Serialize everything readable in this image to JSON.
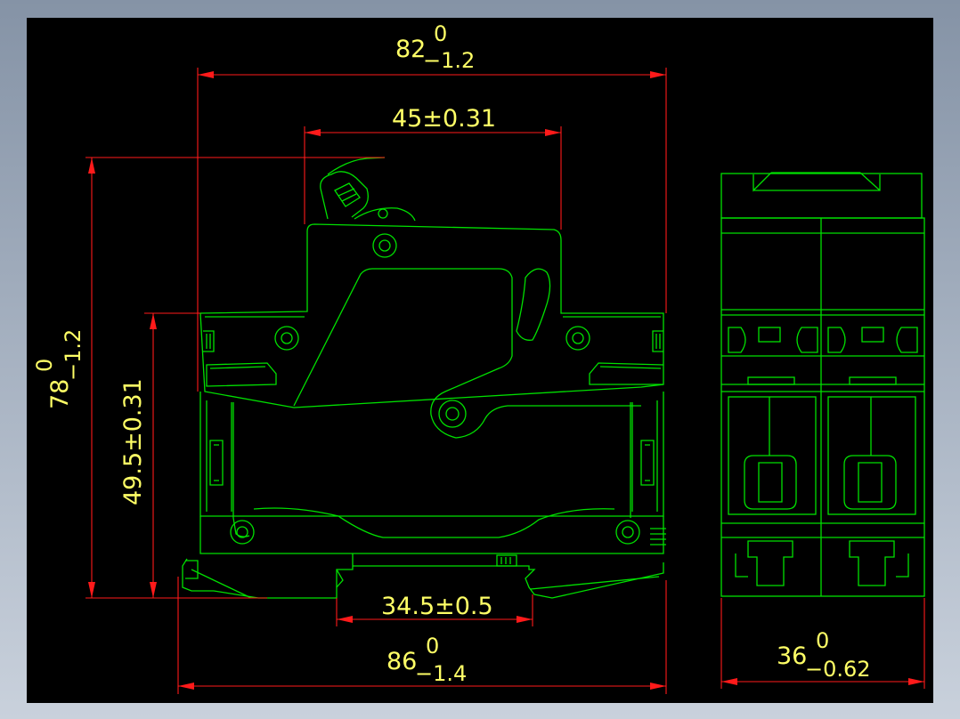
{
  "colors": {
    "viewport_background": "#000000",
    "outline": "#00e000",
    "dimension_line": "#ff1a1a",
    "dimension_text": "#ffff66"
  },
  "dimensions": {
    "top_width": {
      "nominal": "82",
      "upper": "0",
      "lower": "−1.2"
    },
    "handle_span": {
      "text": "45±0.31"
    },
    "overall_height": {
      "nominal": "78",
      "upper": "0",
      "lower": "−1.2"
    },
    "mount_height": {
      "text": "49.5±0.31"
    },
    "rail_width": {
      "text": "34.5±0.5"
    },
    "bottom_width": {
      "nominal": "86",
      "upper": "0",
      "lower": "−1.4"
    },
    "side_width": {
      "nominal": "36",
      "upper": "0",
      "lower": "−0.62"
    }
  }
}
